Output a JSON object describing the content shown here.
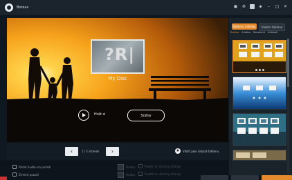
{
  "window": {
    "title": "Boreas",
    "controls": [
      "monitor-icon",
      "gear-icon",
      "info-icon",
      "sticker-icon",
      "minimize",
      "maximize",
      "close"
    ]
  },
  "preview": {
    "disc_name": "My Disc",
    "disc_glyph": "?R|",
    "play_label": "Hrát si",
    "scene_label": "Scény"
  },
  "pagination": {
    "prev": "‹",
    "next": "›",
    "page_text": "1 / 2 stránek",
    "favorite_text": "Vložit jako ukázat šablonu"
  },
  "options": {
    "left": [
      "Přidat hudbu na pozadí",
      "Změnit pozadí"
    ],
    "faint": [
      "Hudba",
      "Použít na všechny stránky",
      "Hudba",
      "Použít na všechny stránky"
    ],
    "menu": "Žádné menu"
  },
  "sidebar": {
    "tabs": [
      "Šablony nabídky",
      "Vlastní šablona"
    ],
    "active_tab": 0,
    "subtabs": [
      "Rodina",
      "Svatba",
      "Dovolená",
      "Události"
    ],
    "active_subtab": 0
  },
  "colors": {
    "accent": "#e58a2c",
    "bg": "#0f1720",
    "titlebar": "#1b242d"
  }
}
